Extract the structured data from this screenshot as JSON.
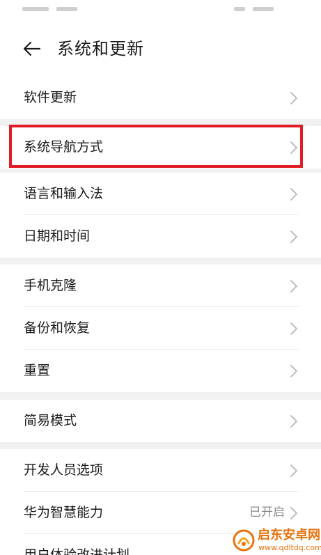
{
  "header": {
    "title": "系统和更新"
  },
  "groups": [
    {
      "items": [
        {
          "label": "软件更新"
        }
      ]
    },
    {
      "items": [
        {
          "label": "系统导航方式"
        }
      ]
    },
    {
      "items": [
        {
          "label": "语言和输入法"
        },
        {
          "label": "日期和时间"
        }
      ]
    },
    {
      "items": [
        {
          "label": "手机克隆"
        },
        {
          "label": "备份和恢复"
        },
        {
          "label": "重置"
        }
      ]
    },
    {
      "items": [
        {
          "label": "简易模式"
        }
      ]
    },
    {
      "items": [
        {
          "label": "开发人员选项"
        },
        {
          "label": "华为智慧能力",
          "value": "已开启"
        },
        {
          "label": "用户体验改进计划"
        }
      ]
    }
  ],
  "watermark": {
    "name": "启东安卓网",
    "url": "www.qdltdq.com"
  },
  "colors": {
    "highlight": "#e11b23",
    "watermark": "#e8720c"
  }
}
